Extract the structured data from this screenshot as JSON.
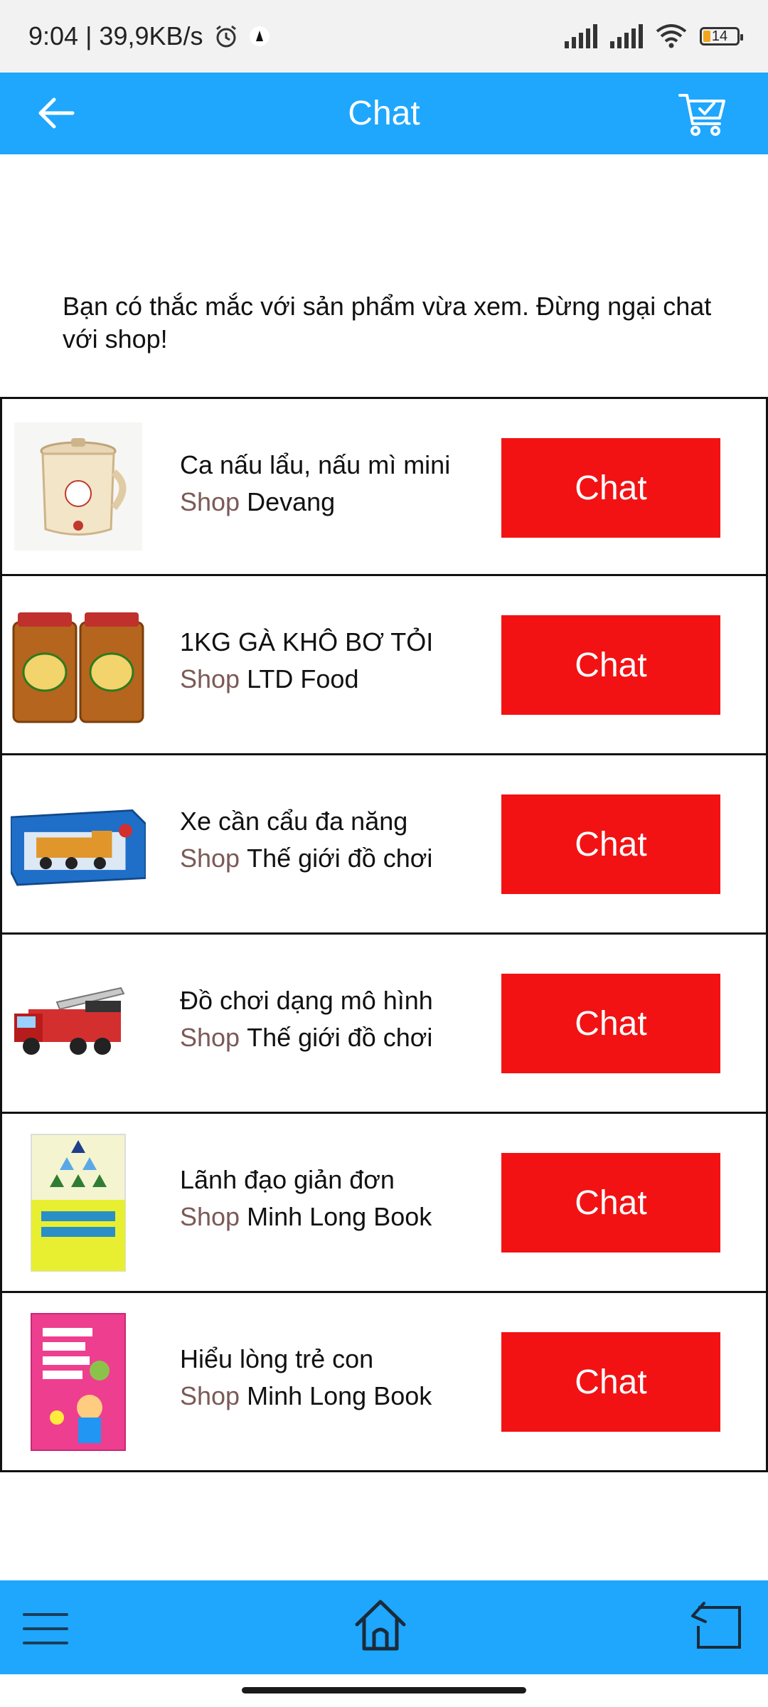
{
  "status_bar": {
    "time_speed": "9:04 | 39,9KB/s",
    "battery": "14"
  },
  "header": {
    "title": "Chat"
  },
  "intro_text": "Bạn có thắc mắc với sản phẩm vừa xem. Đừng ngại chat với shop!",
  "shop_prefix": "Shop",
  "products": [
    {
      "name": "Ca nấu lẩu, nấu mì mini",
      "shop": "Devang",
      "button": "Chat",
      "icon": "kettle-product-image"
    },
    {
      "name": "1KG GÀ KHÔ BƠ TỎI",
      "shop": "LTD Food",
      "button": "Chat",
      "icon": "dried-chicken-jars-image"
    },
    {
      "name": "Xe cần cẩu đa năng",
      "shop": "Thế giới đồ chơi",
      "button": "Chat",
      "icon": "crane-truck-toy-image"
    },
    {
      "name": "Đồ chơi dạng mô hình",
      "shop": "Thế giới đồ chơi",
      "button": "Chat",
      "icon": "fire-truck-model-image"
    },
    {
      "name": "Lãnh đạo giản đơn",
      "shop": "Minh Long Book",
      "button": "Chat",
      "icon": "book-cover-leadership-image"
    },
    {
      "name": "Hiểu lòng trẻ con",
      "shop": "Minh Long Book",
      "button": "Chat",
      "icon": "book-cover-children-image"
    }
  ],
  "colors": {
    "primary": "#1ea7fd",
    "chat_button": "#f21214",
    "shop_label": "#7b5a56"
  }
}
